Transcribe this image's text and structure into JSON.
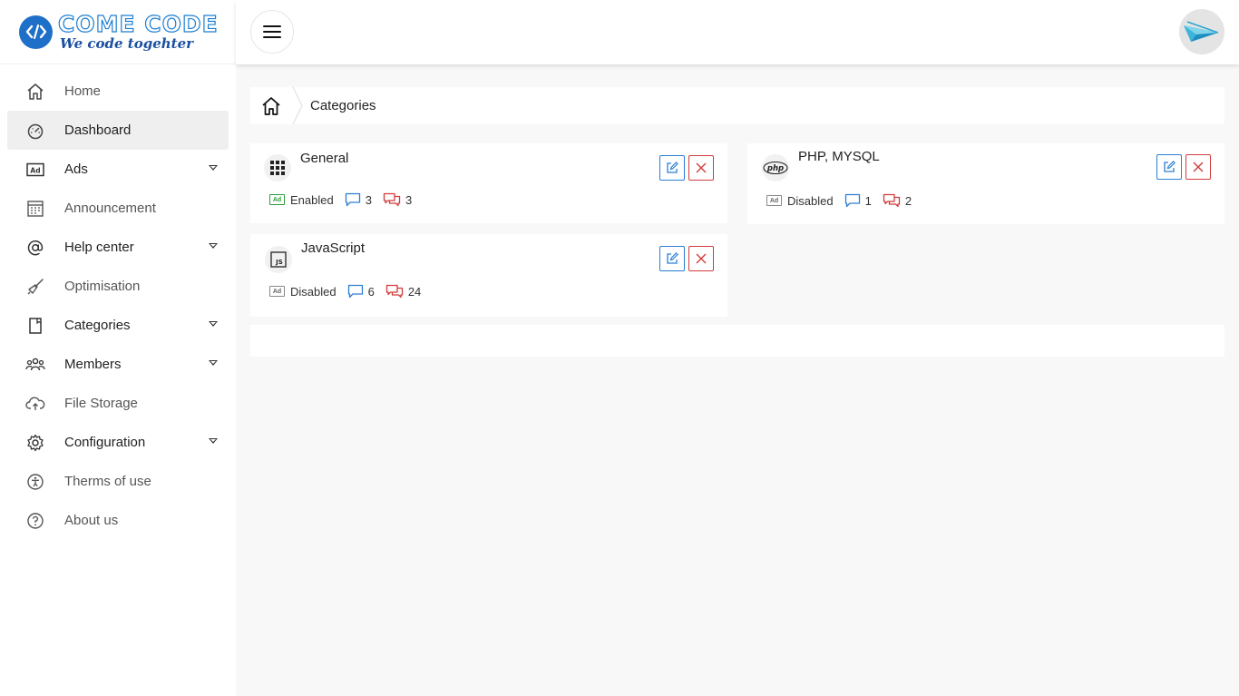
{
  "brand": {
    "title": "COME CODE",
    "subtitle": "We code togehter"
  },
  "sidebar": {
    "items": [
      {
        "label": "Home",
        "icon": "home-icon"
      },
      {
        "label": "Dashboard",
        "icon": "speedometer-icon",
        "active": true
      },
      {
        "label": "Ads",
        "icon": "ad-icon",
        "expandable": true
      },
      {
        "label": "Announcement",
        "icon": "calendar-grid-icon"
      },
      {
        "label": "Help center",
        "icon": "at-icon",
        "expandable": true
      },
      {
        "label": "Optimisation",
        "icon": "brush-icon"
      },
      {
        "label": "Categories",
        "icon": "bookmark-icon",
        "expandable": true
      },
      {
        "label": "Members",
        "icon": "members-icon",
        "expandable": true
      },
      {
        "label": "File Storage",
        "icon": "cloud-upload-icon"
      },
      {
        "label": "Configuration",
        "icon": "gear-icon",
        "expandable": true
      },
      {
        "label": "Therms of use",
        "icon": "accessibility-icon"
      },
      {
        "label": "About us",
        "icon": "question-circle-icon"
      }
    ]
  },
  "breadcrumb": {
    "current": "Categories"
  },
  "categories": [
    {
      "name": "General",
      "icon": "grid-icon",
      "ads_status": "Enabled",
      "ads_enabled": true,
      "topics": "3",
      "replies": "3"
    },
    {
      "name": "PHP, MYSQL",
      "icon": "php-icon",
      "ads_status": "Disabled",
      "ads_enabled": false,
      "topics": "1",
      "replies": "2"
    },
    {
      "name": "JavaScript",
      "icon": "js-icon",
      "ads_status": "Disabled",
      "ads_enabled": false,
      "topics": "6",
      "replies": "24"
    }
  ],
  "colors": {
    "accent_blue": "#2a7fd4",
    "danger_red": "#d23b3b",
    "enabled_green": "#2e9e3a",
    "brand_blue": "#1e6fc7"
  }
}
